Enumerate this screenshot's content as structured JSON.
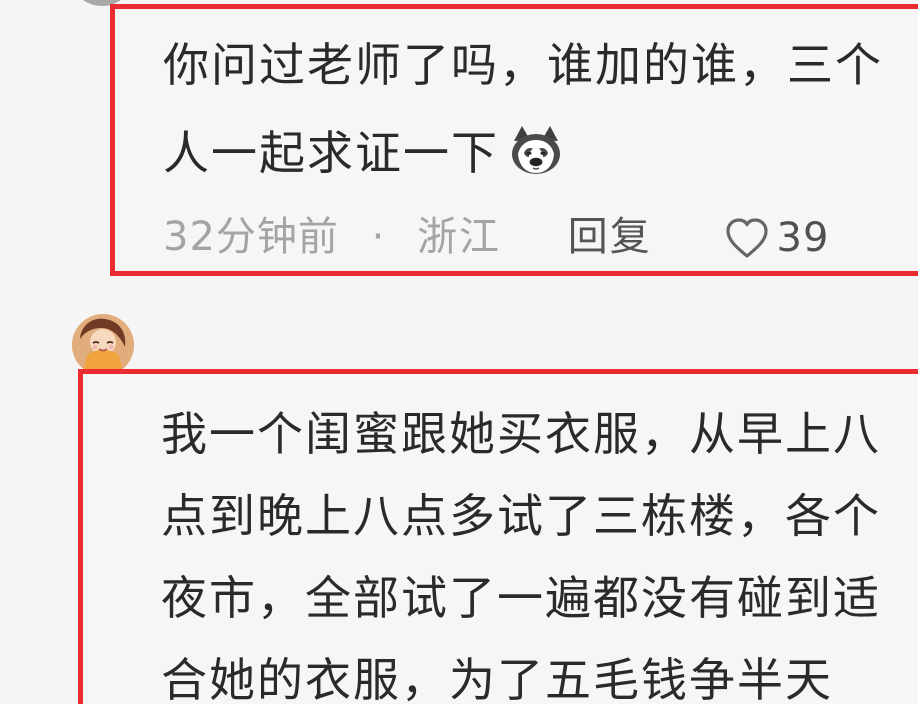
{
  "comments": [
    {
      "text_lines": [
        "你问过老师了吗，谁加的谁，三个",
        "人一起求证一下"
      ],
      "emoji": "husky-emoji-icon",
      "time": "32分钟前",
      "separator": "·",
      "location": "浙江",
      "reply_label": "回复",
      "likes": "39"
    },
    {
      "avatar": "avatar-girl-icon",
      "text_lines": [
        "我一个闺蜜跟她买衣服，从早上八",
        "点到晚上八点多试了三栋楼，各个",
        "夜市，全部试了一遍都没有碰到适",
        "合她的衣服，为了五毛钱争半天"
      ]
    }
  ],
  "colors": {
    "highlight_border": "#ea2b2f",
    "text": "#2a2a2a",
    "meta": "#a4a4a4",
    "background": "#f5f5f5"
  },
  "icons": [
    "husky-emoji-icon",
    "heart-icon",
    "avatar-girl-icon"
  ]
}
